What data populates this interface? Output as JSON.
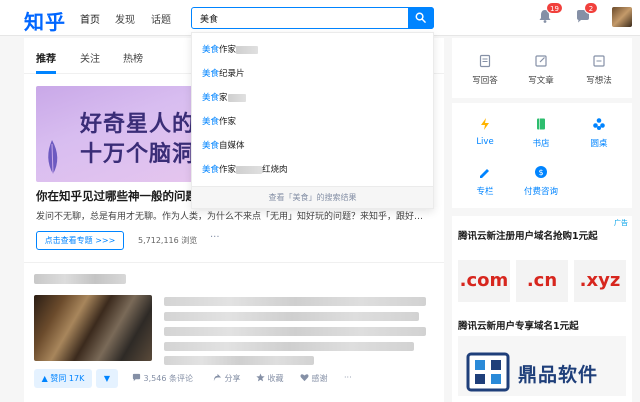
{
  "header": {
    "logo": "知乎",
    "nav": {
      "home": "首页",
      "discover": "发现",
      "topics": "话题"
    },
    "search": {
      "value": "美食",
      "placeholder": ""
    },
    "notifications_count": "19",
    "messages_count": "2"
  },
  "search_dropdown": {
    "suggestions": [
      {
        "keyword": "美食",
        "rest": "作家",
        "blurred": true,
        "suffix": ""
      },
      {
        "keyword": "美食",
        "rest": "纪录片",
        "blurred": false,
        "suffix": ""
      },
      {
        "keyword": "美食",
        "rest": "家",
        "blurred": true,
        "suffix": ""
      },
      {
        "keyword": "美食",
        "rest": "作家",
        "blurred": false,
        "suffix": ""
      },
      {
        "keyword": "美食",
        "rest": "自媒体",
        "blurred": false,
        "suffix": ""
      },
      {
        "keyword": "美食",
        "rest": "作家",
        "blurred": true,
        "suffix": "红烧肉"
      }
    ],
    "footer": "查看「美食」的搜索结果"
  },
  "feed": {
    "tabs": {
      "recommend": "推荐",
      "follow": "关注",
      "hot": "热榜"
    },
    "card1": {
      "banner_line1": "好奇星人的",
      "banner_line2": "十万个脑洞",
      "title": "你在知乎见过哪些神一般的问题",
      "excerpt": "发问不无聊，总是有用才无聊。作为人类，为什么不来点「无用」知好玩的问题？来知乎，跟好…",
      "topic_button": "点击查看专题 >>>",
      "views": "5,712,116 浏览",
      "more": "···"
    },
    "card2": {
      "vote_label": "▲ 赞同 17K",
      "vote_down": "▼",
      "comments": "3,546 条评论",
      "share": "分享",
      "collect": "收藏",
      "thanks": "感谢",
      "more": "···"
    }
  },
  "sidebar": {
    "quick_actions": [
      {
        "label": "写回答",
        "icon": "write-answer-icon"
      },
      {
        "label": "写文章",
        "icon": "write-article-icon"
      },
      {
        "label": "写想法",
        "icon": "write-idea-icon"
      }
    ],
    "links": [
      {
        "label": "Live",
        "icon": "live-icon",
        "color": "#ffb400"
      },
      {
        "label": "书店",
        "icon": "bookstore-icon",
        "color": "#2dbd6e"
      },
      {
        "label": "圆桌",
        "icon": "roundtable-icon",
        "color": "#0084ff"
      },
      {
        "label": "专栏",
        "icon": "column-icon",
        "color": "#0084ff"
      },
      {
        "label": "付费咨询",
        "icon": "paid-consult-icon",
        "color": "#0084ff"
      }
    ]
  },
  "ad": {
    "tag": "广告",
    "title": "腾讯云新注册用户域名抢购1元起",
    "domains": [
      ".com",
      ".cn",
      ".xyz"
    ],
    "title2": "腾讯云新用户专享域名1元起"
  },
  "watermark": {
    "text": "鼎品软件"
  },
  "colors": {
    "brand": "#0084ff",
    "badge": "#f1403c",
    "banner_text": "#3a2d77"
  }
}
